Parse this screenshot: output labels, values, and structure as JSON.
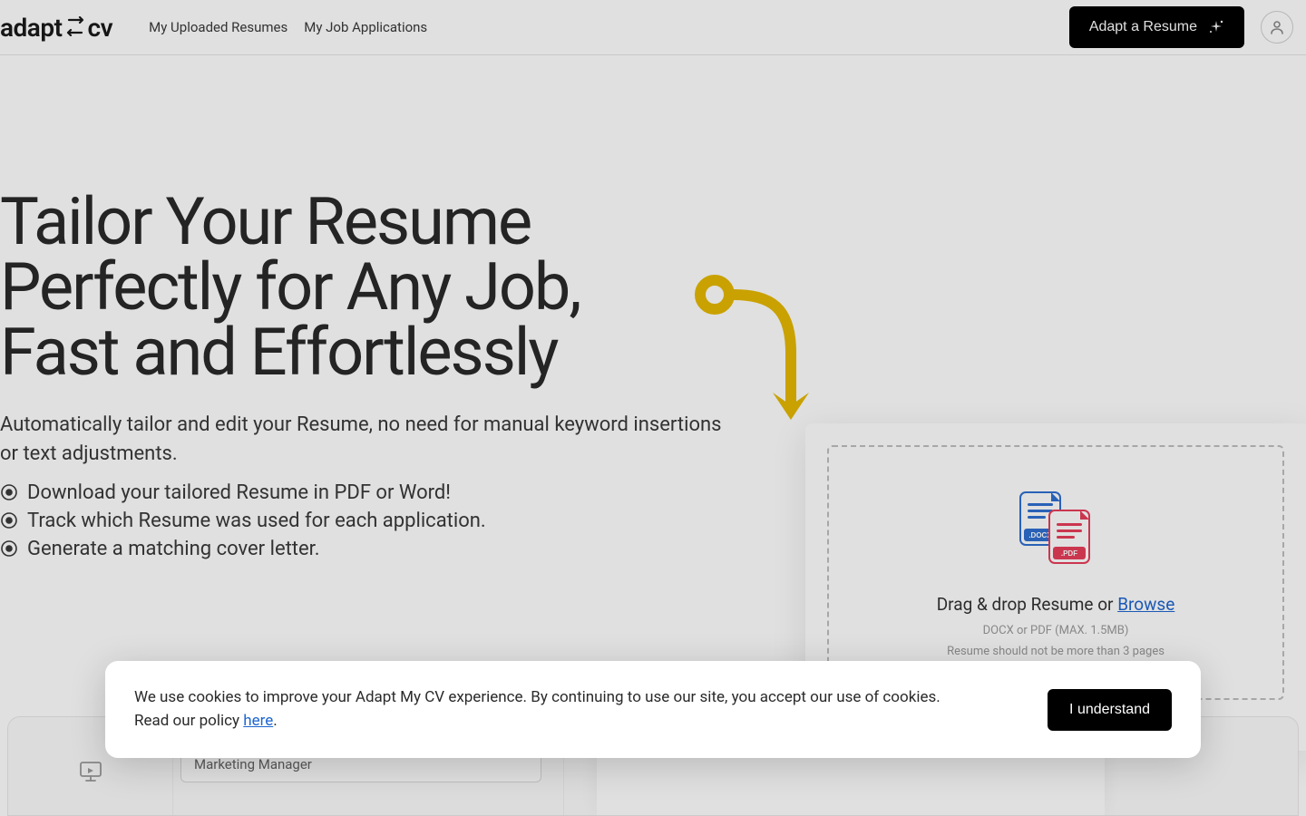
{
  "header": {
    "logo_text_1": "adapt",
    "logo_text_2": "cv",
    "nav": {
      "uploaded": "My Uploaded Resumes",
      "applications": "My Job Applications"
    },
    "adapt_button": "Adapt a Resume"
  },
  "hero": {
    "title": "Tailor Your Resume Perfectly for Any Job, Fast and Effortlessly",
    "subtitle": "Automatically tailor and edit your Resume, no need for manual keyword insertions or text adjustments.",
    "features": [
      "Download your tailored Resume in PDF or Word!",
      "Track which Resume was used for each application.",
      "Generate a matching cover letter."
    ]
  },
  "upload": {
    "drop_prefix": "Drag & drop Resume or ",
    "browse": "Browse",
    "hint1": "DOCX or PDF (MAX. 1.5MB)",
    "hint2": "Resume should not be more than 3 pages",
    "docx_badge": ".DOCX",
    "pdf_badge": ".PDF"
  },
  "preview": {
    "input_value": "Marketing Manager"
  },
  "cookie": {
    "text_1": "We use cookies to improve your Adapt My CV experience. By continuing to use our site, you accept our use of cookies. Read our policy ",
    "link": "here",
    "text_2": ".",
    "button": "I understand"
  },
  "colors": {
    "accent_yellow": "#e5b800",
    "link_blue": "#1e66d0",
    "docx_blue": "#2f6fd1",
    "pdf_red": "#e83e5a"
  }
}
